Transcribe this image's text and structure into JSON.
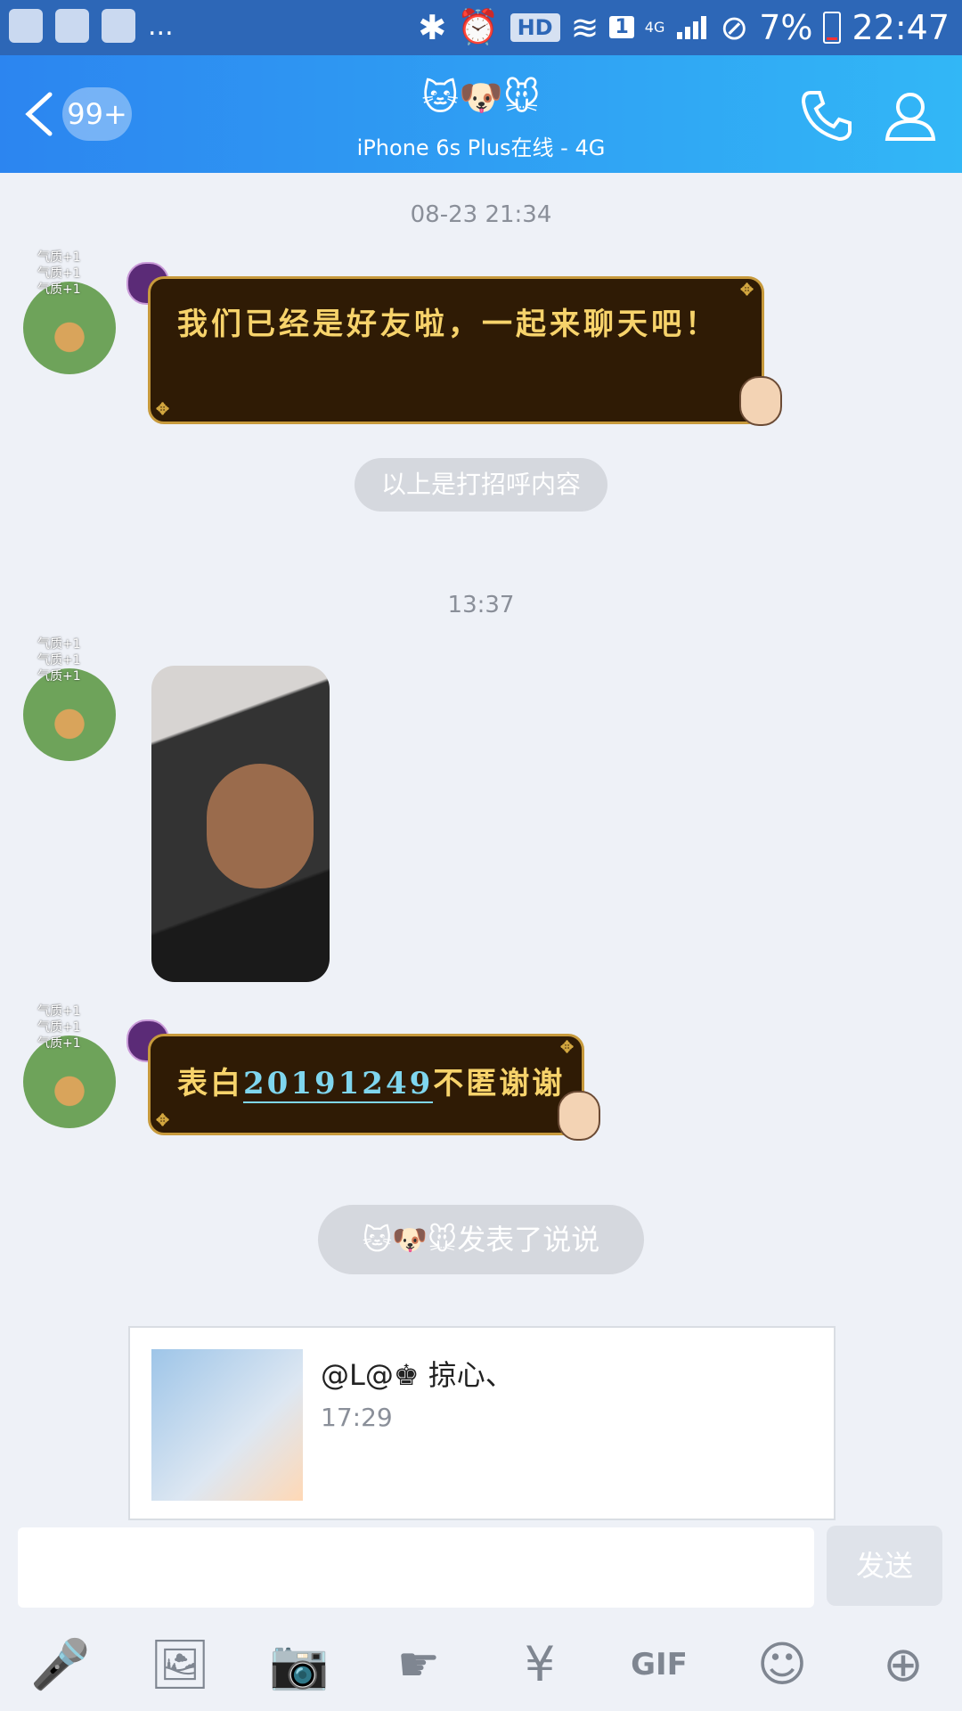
{
  "status_bar": {
    "hd": "HD",
    "sim": "1",
    "net": "4G",
    "battery_percent": "7%",
    "time": "22:47",
    "more": "...",
    "icons": [
      "app-icon",
      "news-icon",
      "gallery-icon",
      "bluetooth-icon",
      "alarm-icon",
      "wifi-icon",
      "signal-icon",
      "dnd-icon",
      "battery-icon"
    ]
  },
  "header": {
    "unread_count": "99+",
    "title_emojis": "🐱🐶🐭",
    "subtitle": "iPhone 6s Plus在线 - 4G"
  },
  "chat": {
    "timestamp1": "08-23 21:34",
    "message1": "我们已经是好友啦，一起来聊天吧！",
    "avatar_deco": [
      "气质+1",
      "气质+1",
      "气质+1",
      "气质+1"
    ],
    "greeting_pill": "以上是打招呼内容",
    "timestamp2": "13:37",
    "message2_prefix": "表白",
    "message2_link": "20191249",
    "message2_suffix": "不匿谢谢",
    "share_pill": "🐱🐶🐭发表了说说",
    "share_card": {
      "name": "@L@♚ 掠心、",
      "time": "17:29"
    }
  },
  "input_bar": {
    "send_label": "发送",
    "tools": [
      "microphone-icon",
      "image-icon",
      "camera-icon",
      "poke-icon",
      "red-packet-icon",
      "gif-icon",
      "emoji-icon",
      "plus-icon"
    ],
    "gif_label": "GIF"
  },
  "colors": {
    "header_gradient_start": "#2c85f0",
    "header_gradient_end": "#32b7f6",
    "bubble_bg": "#2f1b05",
    "bubble_text": "#f7d36b",
    "link": "#7fd6ee"
  }
}
